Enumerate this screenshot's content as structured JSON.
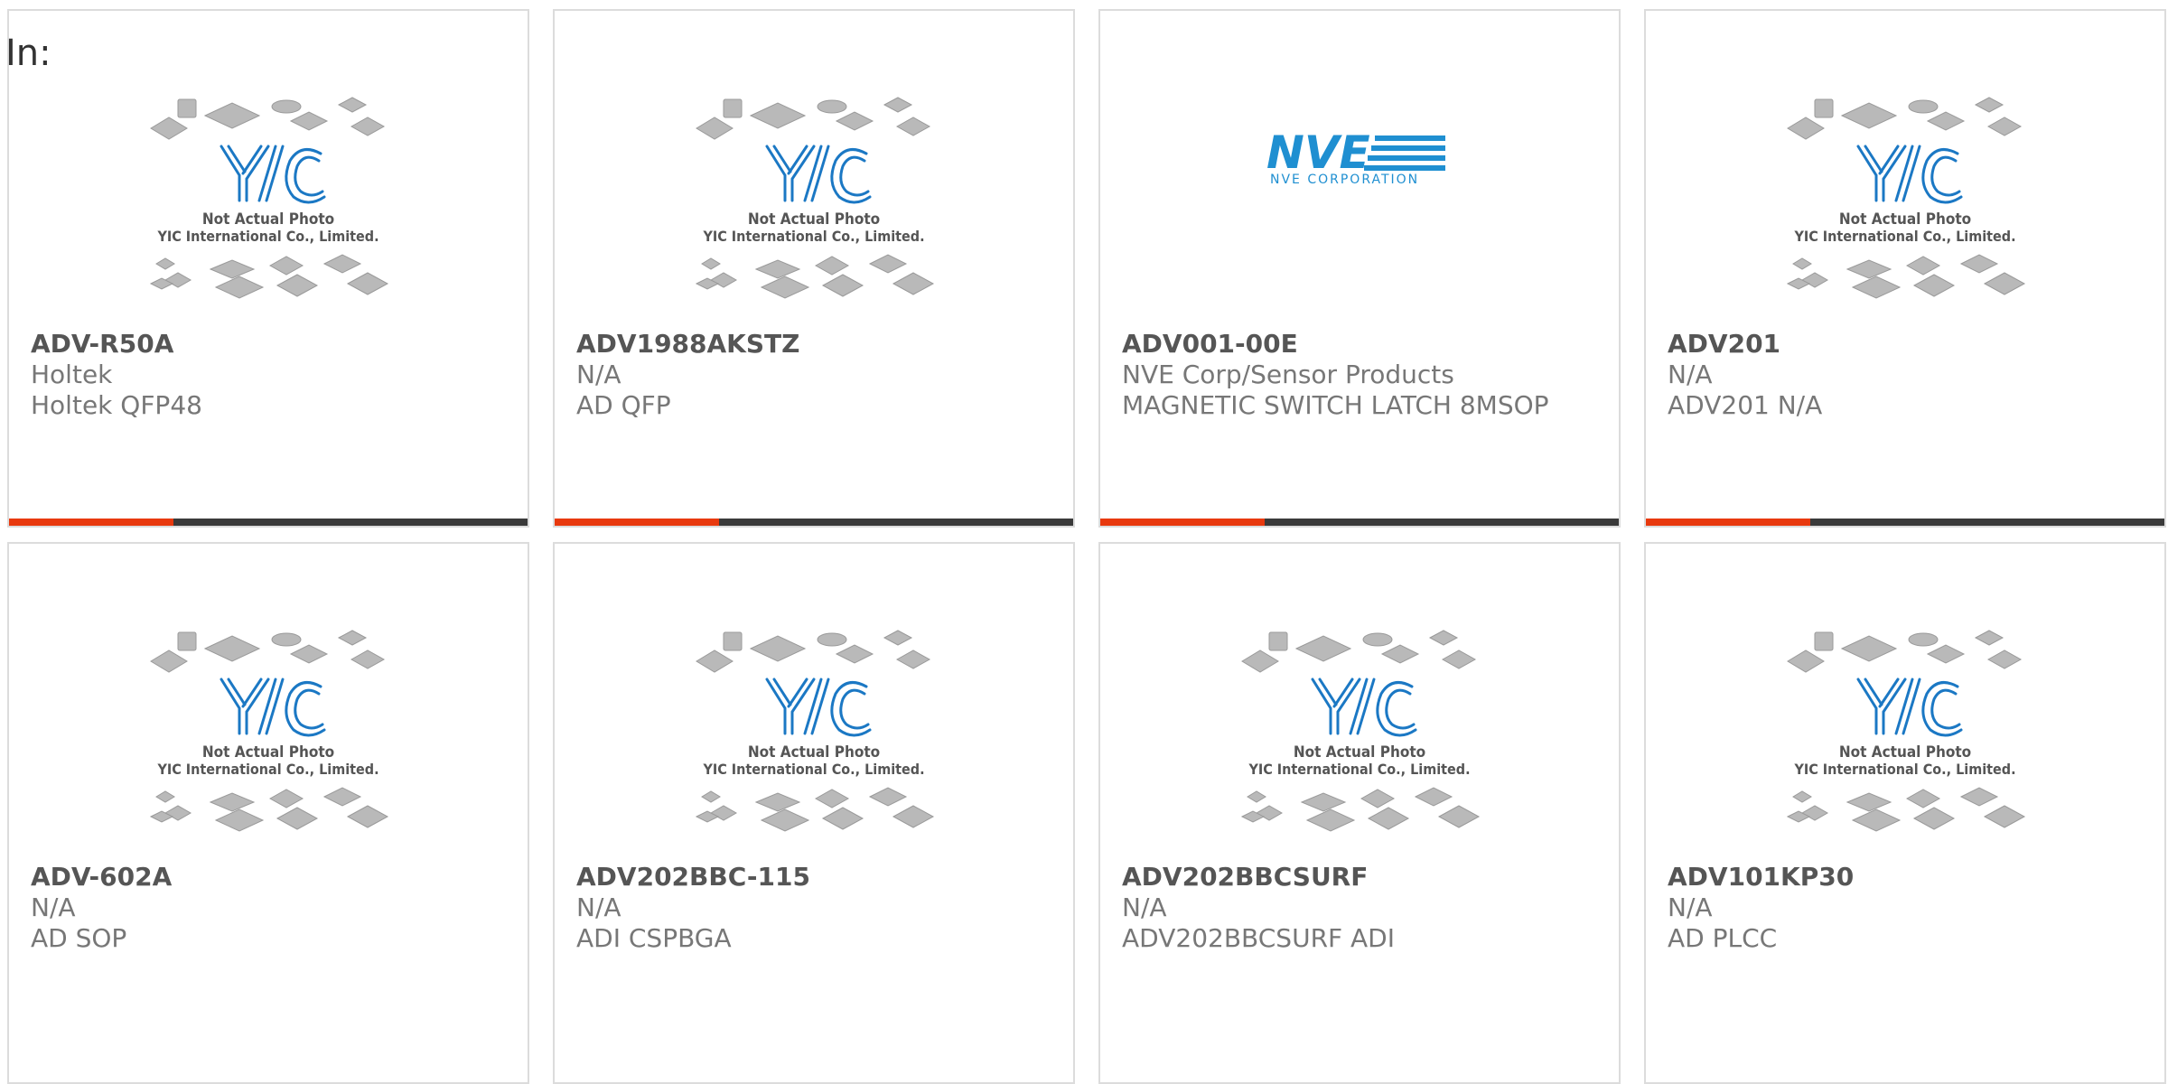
{
  "header": {
    "label": "In:"
  },
  "placeholder": {
    "line1": "Not Actual Photo",
    "line2": "YIC International Co., Limited.",
    "brand": "YIC"
  },
  "nve_logo": {
    "brand": "NVE",
    "tagline": "NVE CORPORATION",
    "color": "#1f8fd1"
  },
  "colors": {
    "accent": "#e8390e",
    "bar": "#3a3a3a",
    "yic_blue": "#1b78c4"
  },
  "products": [
    {
      "part": "ADV-R50A",
      "maker": "Holtek",
      "desc": "Holtek QFP48",
      "image": "placeholder"
    },
    {
      "part": "ADV1988AKSTZ",
      "maker": "N/A",
      "desc": "AD QFP",
      "image": "placeholder"
    },
    {
      "part": "ADV001-00E",
      "maker": "NVE Corp/Sensor Products",
      "desc": "MAGNETIC SWITCH LATCH 8MSOP",
      "image": "nve-logo"
    },
    {
      "part": "ADV201",
      "maker": "N/A",
      "desc": "ADV201 N/A",
      "image": "placeholder"
    },
    {
      "part": "ADV-602A",
      "maker": "N/A",
      "desc": "AD SOP",
      "image": "placeholder"
    },
    {
      "part": "ADV202BBC-115",
      "maker": "N/A",
      "desc": "ADI CSPBGA",
      "image": "placeholder"
    },
    {
      "part": "ADV202BBCSURF",
      "maker": "N/A",
      "desc": "ADV202BBCSURF ADI",
      "image": "placeholder"
    },
    {
      "part": "ADV101KP30",
      "maker": "N/A",
      "desc": "AD PLCC",
      "image": "placeholder"
    }
  ]
}
